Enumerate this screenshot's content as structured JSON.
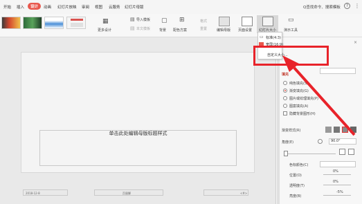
{
  "menu": {
    "tabs": [
      "开始",
      "插入",
      "设计",
      "动画",
      "幻灯片放映",
      "审阅",
      "视图",
      "云服务",
      "幻灯片母版"
    ],
    "active_tab": "设计",
    "search_text": "Q查找命令、搜索模板",
    "help_label": "?",
    "more_label": "⋮"
  },
  "toolbar": {
    "more_design": "更多设计",
    "import_template": "导入模板",
    "current_template": "本文模板",
    "background": "背景",
    "color_scheme": "配色方案",
    "format": "格式",
    "reset": "重置",
    "edit_master": "编辑母版",
    "page_setup": "页面设置",
    "slide_size": "幻灯片大小",
    "presenter_tools": "演示工具",
    "accent_color": "#e8574c"
  },
  "dropdown": {
    "items": [
      "标准(4:3)",
      "宽屏(16:9)",
      "自定义大小..."
    ]
  },
  "slide": {
    "title_placeholder": "单击此处编辑母版标题样式",
    "footer_date": "2018-12-8",
    "footer_center": "页眉脚",
    "footer_num": "<#>"
  },
  "panel": {
    "section_label": "填充",
    "options": [
      "纯色填充(S)",
      "渐变填充(G)",
      "图片或纹理填充(P)",
      "图案填充(A)"
    ],
    "selected_option": "渐变填充(G)",
    "hide_bg": "隐藏背景图形(H)",
    "gradient_style_label": "渐变样式(R)",
    "angle_label": "角度(E)",
    "angle_value": "90.0°",
    "color_label": "色标颜色(C)",
    "position_label": "位置(O)",
    "position_value": "0%",
    "transparency_label": "透明度(T)",
    "transparency_value": "0%",
    "brightness_label": "亮度(B)",
    "brightness_value": "-5%"
  },
  "colors": {
    "highlight_red": "#e8232a",
    "active_tab": "#e8574c"
  }
}
